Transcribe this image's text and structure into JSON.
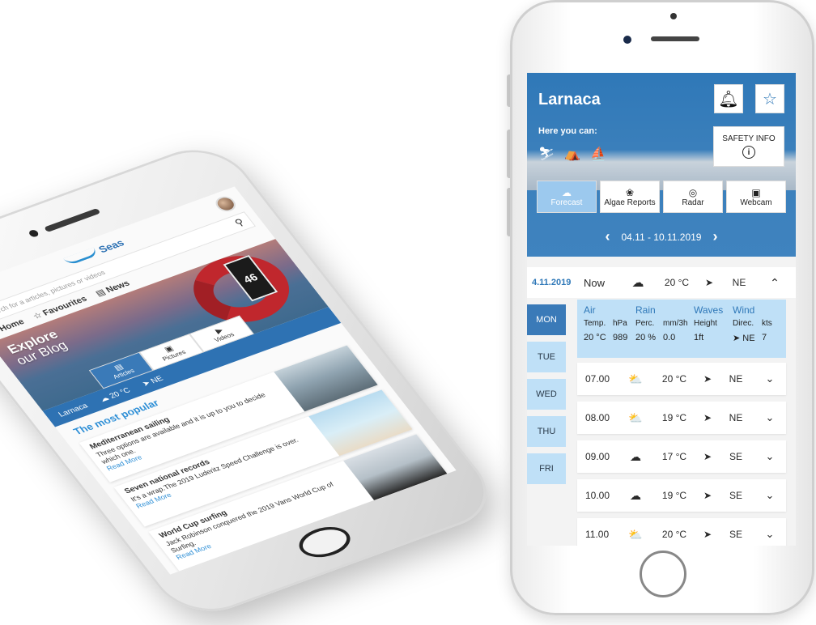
{
  "blog_app": {
    "logo_text": "Seas",
    "search_placeholder": "Search for a articles, pictures or videos",
    "nav": [
      {
        "label": "Home"
      },
      {
        "label": "Favourites"
      },
      {
        "label": "News"
      }
    ],
    "hero_title_line1": "Explore",
    "hero_title_line2": "our Blog",
    "hero_sign": "46",
    "tabs": [
      {
        "label": "Articles"
      },
      {
        "label": "Pictures"
      },
      {
        "label": "Videos"
      }
    ],
    "weather_location": "Larnaca",
    "weather_temp": "20 °C",
    "weather_wind": "NE",
    "section_title": "The most popular",
    "articles": [
      {
        "title": "Mediterranean sailing",
        "text": "Three options are available and it is up to you to decide which one.",
        "link": "Read More"
      },
      {
        "title": "Seven national records",
        "text": "It's a wrap.The 2019 Luderitz Speed Challenge is over.",
        "link": "Read More"
      },
      {
        "title": "World Cup surfing",
        "text": "Jack Robinson conquered the 2019 Vans World Cup of Surfing.",
        "link": "Read More"
      }
    ]
  },
  "weather_app": {
    "city": "Larnaca",
    "here_you_can": "Here you can:",
    "safety_info": "SAFETY INFO",
    "tabs": [
      {
        "label": "Forecast"
      },
      {
        "label": "Algae Reports"
      },
      {
        "label": "Radar"
      },
      {
        "label": "Webcam"
      }
    ],
    "date_range": "04.11 - 10.11.2019",
    "now_row": {
      "date": "4.11.2019",
      "label": "Now",
      "temp": "20 °C",
      "wind": "NE"
    },
    "days": [
      {
        "label": "MON"
      },
      {
        "label": "TUE"
      },
      {
        "label": "WED"
      },
      {
        "label": "THU"
      },
      {
        "label": "FRI"
      }
    ],
    "detail": {
      "headers": [
        "Air",
        "Rain",
        "Waves",
        "Wind"
      ],
      "subheaders": [
        "Temp.",
        "hPa",
        "Perc.",
        "mm/3h",
        "Height",
        "Direc.",
        "kts"
      ],
      "values": [
        "20 °C",
        "989",
        "20 %",
        "0.0",
        "1ft",
        "NE",
        "7"
      ]
    },
    "hours": [
      {
        "time": "07.00",
        "temp": "20 °C",
        "wind": "NE",
        "icon": "sun-cloud"
      },
      {
        "time": "08.00",
        "temp": "19 °C",
        "wind": "NE",
        "icon": "sun-cloud"
      },
      {
        "time": "09.00",
        "temp": "17 °C",
        "wind": "SE",
        "icon": "rain-cloud"
      },
      {
        "time": "10.00",
        "temp": "19 °C",
        "wind": "SE",
        "icon": "rain-cloud"
      },
      {
        "time": "11.00",
        "temp": "20 °C",
        "wind": "SE",
        "icon": "sun-cloud"
      }
    ]
  }
}
